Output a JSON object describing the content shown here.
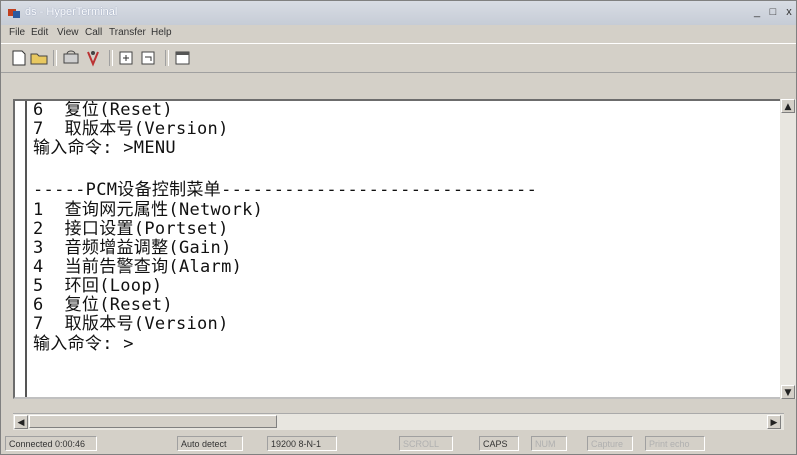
{
  "window": {
    "title": "ds - HyperTerminal"
  },
  "window_controls": {
    "minimize": "_",
    "maximize": "□",
    "close": "x"
  },
  "menu": [
    "File",
    "Edit",
    "View",
    "Call",
    "Transfer",
    "Help"
  ],
  "toolbar_icons": [
    "new-connection-icon",
    "open-icon",
    "connect-icon",
    "disconnect-icon",
    "send-icon",
    "receive-icon",
    "properties-icon"
  ],
  "terminal": {
    "lines": [
      "6  复位(Reset)",
      "7  取版本号(Version)",
      "输入命令: >MENU",
      "",
      "-----PCM设备控制菜单------------------------------",
      "1  查询网元属性(Network)",
      "2  接口设置(Portset)",
      "3  音频增益调整(Gain)",
      "4  当前告警查询(Alarm)",
      "5  环回(Loop)",
      "6  复位(Reset)",
      "7  取版本号(Version)",
      "输入命令: >"
    ]
  },
  "status": {
    "connected": "Connected 0:00:46",
    "detect": "Auto detect",
    "params": "19200 8-N-1",
    "scroll": "SCROLL",
    "caps": "CAPS",
    "num": "NUM",
    "capture": "Capture",
    "print_echo": "Print echo"
  }
}
